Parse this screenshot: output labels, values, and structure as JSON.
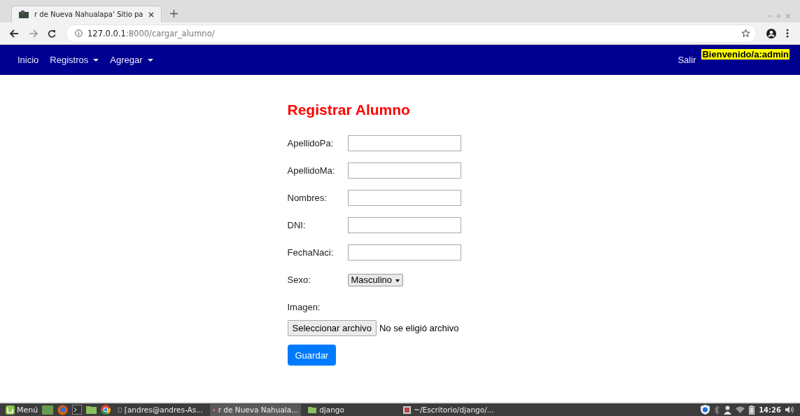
{
  "browser": {
    "tab_title": "r de Nueva Nahualapa' Sitio pa",
    "url_host": "127.0.0.1",
    "url_path": ":8000/cargar_alumno/"
  },
  "nav": {
    "items": [
      {
        "label": "Inicio",
        "dropdown": false
      },
      {
        "label": "Registros",
        "dropdown": true
      },
      {
        "label": "Agregar",
        "dropdown": true
      }
    ],
    "logout": "Salir",
    "welcome": "Bienvenido/a:admin"
  },
  "form": {
    "title": "Registrar Alumno",
    "fields": [
      {
        "label": "ApellidoPa:",
        "kind": "text"
      },
      {
        "label": "ApellidoMa:",
        "kind": "text"
      },
      {
        "label": "Nombres:",
        "kind": "text"
      },
      {
        "label": "DNI:",
        "kind": "text"
      },
      {
        "label": "FechaNaci:",
        "kind": "text"
      },
      {
        "label": "Sexo:",
        "kind": "select",
        "value": "Masculino"
      }
    ],
    "image_label": "Imagen:",
    "file_button": "Seleccionar archivo",
    "file_status": "No se eligió archivo",
    "submit": "Guardar"
  },
  "taskbar": {
    "menu": "Menú",
    "windows": [
      {
        "label": "[andres@andres-As...",
        "kind": "terminal",
        "selected": false
      },
      {
        "label": "r de Nueva Nahuala...",
        "kind": "browser",
        "selected": true
      },
      {
        "label": "django",
        "kind": "folder",
        "selected": false
      },
      {
        "label": "~/Escritorio/django/...",
        "kind": "editor",
        "selected": false
      }
    ],
    "clock": "14:26"
  }
}
